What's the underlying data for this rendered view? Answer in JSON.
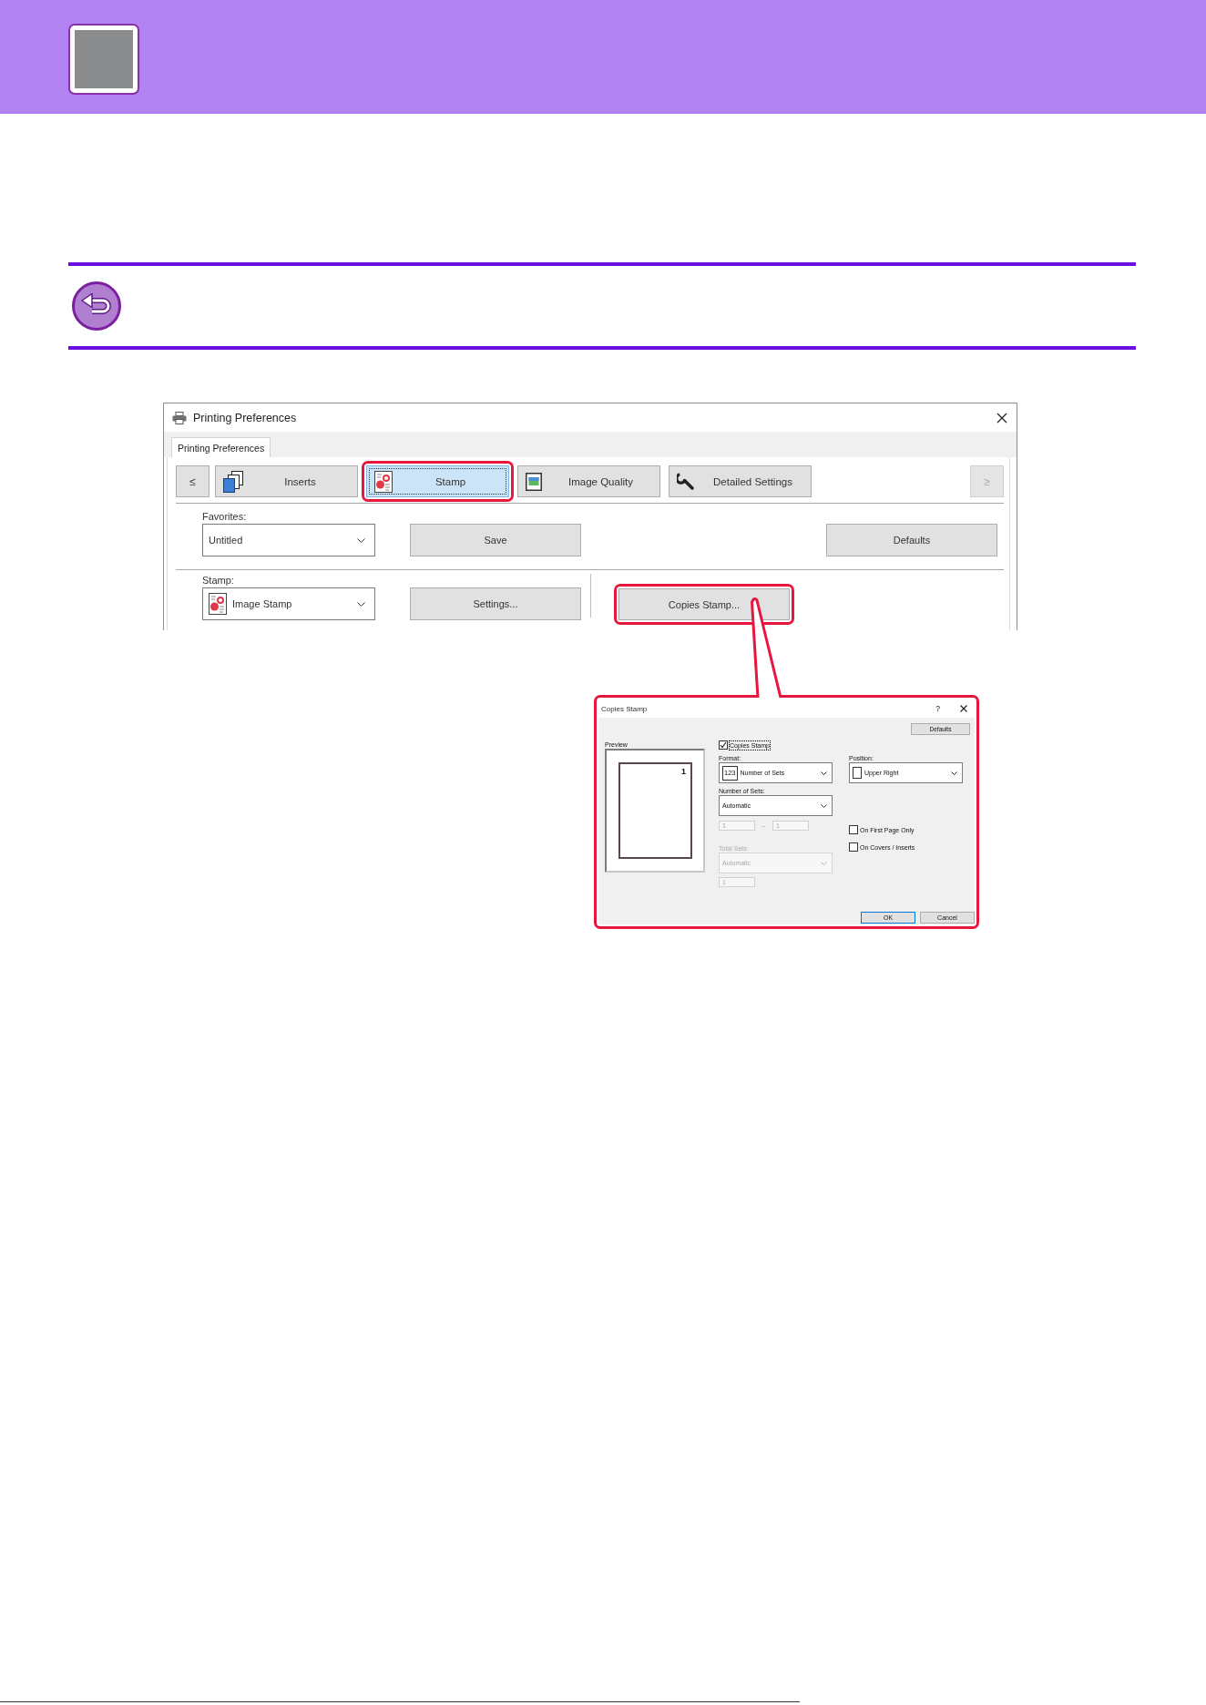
{
  "printing_preferences": {
    "title": "Printing Preferences",
    "sheet_tabs": [
      {
        "label": "Printing Preferences",
        "selected": true
      }
    ],
    "nav_back": {
      "label": "≤",
      "disabled": false
    },
    "tabs": [
      {
        "label": "Inserts",
        "selected": false,
        "highlighted": false
      },
      {
        "label": "Stamp",
        "selected": true,
        "highlighted": true
      },
      {
        "label": "Image Quality",
        "selected": false,
        "highlighted": false
      },
      {
        "label": "Detailed Settings",
        "selected": false,
        "highlighted": false
      }
    ],
    "nav_forward": {
      "label": "≥",
      "disabled": true
    },
    "favorites": {
      "label": "Favorites:",
      "value": "Untitled"
    },
    "save_button": "Save",
    "defaults_button": "Defaults",
    "stamp": {
      "label": "Stamp:",
      "value": "Image Stamp"
    },
    "settings_button": "Settings...",
    "copies_stamp_button": {
      "label": "Copies Stamp...",
      "highlighted": true
    }
  },
  "copies_stamp_dialog": {
    "title": "Copies Stamp",
    "help": "?",
    "defaults_button": "Defaults",
    "preview": {
      "label": "Preview",
      "page_number": "1"
    },
    "copies_stamp": {
      "label": "Copies Stamp",
      "checked": true,
      "focused": true
    },
    "format": {
      "label": "Format:",
      "badge": "123",
      "value": "Number of Sets"
    },
    "number_of_sets": {
      "label": "Number of Sets:",
      "value": "Automatic"
    },
    "range": {
      "from": "1",
      "separator": "–",
      "to": "1",
      "disabled": true
    },
    "total_sets": {
      "label": "Total Sets:",
      "value": "Automatic",
      "count": "1",
      "disabled": true
    },
    "position": {
      "label": "Position:",
      "value": "Upper Right"
    },
    "options": [
      {
        "label": "On First Page Only",
        "checked": false,
        "focused": false
      },
      {
        "label": "On Covers / Inserts",
        "checked": false,
        "focused": false
      }
    ],
    "buttons": [
      {
        "label": "OK",
        "default": true
      },
      {
        "label": "Cancel",
        "default": false
      }
    ]
  }
}
